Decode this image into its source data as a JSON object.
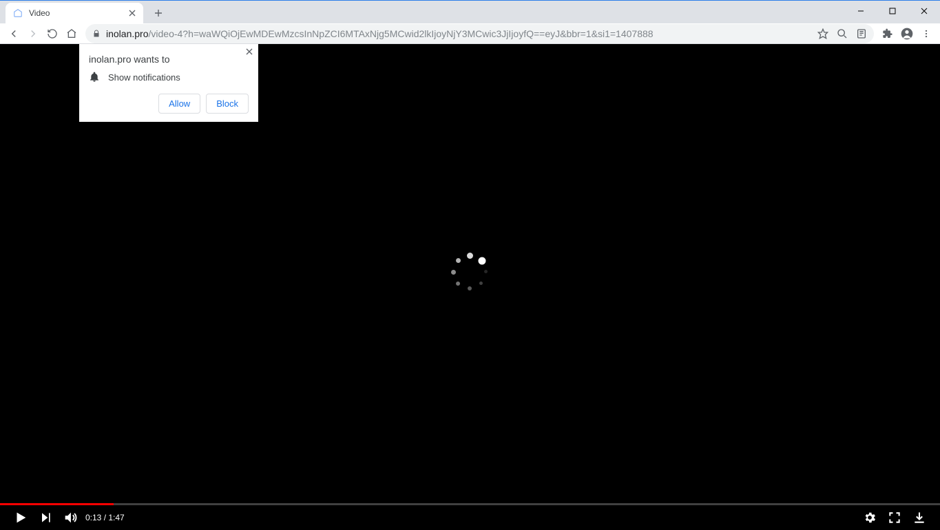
{
  "tab": {
    "title": "Video"
  },
  "url": {
    "host": "inolan.pro",
    "path": "/video-4?h=waWQiOjEwMDEwMzcsInNpZCI6MTAxNjg5MCwid2lkIjoyNjY3MCwic3JjIjoyfQ==eyJ&bbr=1&si1=1407888"
  },
  "permission": {
    "title": "inolan.pro wants to",
    "item": "Show notifications",
    "allow": "Allow",
    "block": "Block"
  },
  "player": {
    "current": "0:13",
    "sep": " / ",
    "total": "1:47",
    "progress_percent": 12.1
  }
}
